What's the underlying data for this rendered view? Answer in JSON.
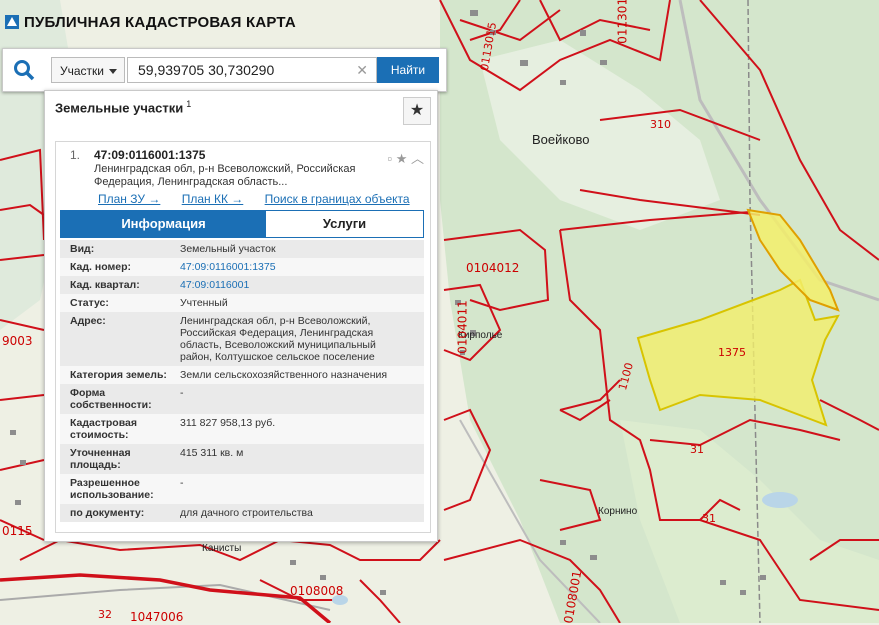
{
  "app": {
    "title": "ПУБЛИЧНАЯ КАДАСТРОВАЯ КАРТА"
  },
  "search": {
    "type_selected": "Участки",
    "query": "59,939705 30,730290",
    "button": "Найти"
  },
  "panel": {
    "title": "Земельные участки",
    "count": "1",
    "result": {
      "index": "1.",
      "cad_number": "47:09:0116001:1375",
      "address_short": "Ленинградская обл, р-н Всеволожский, Российская Федерация, Ленинградская область...",
      "links": [
        "План ЗУ →",
        "План КК →",
        "Поиск в границах объекта →"
      ],
      "tabs": [
        "Информация",
        "Услуги"
      ],
      "rows": [
        {
          "k": "Вид:",
          "v": "Земельный участок"
        },
        {
          "k": "Кад. номер:",
          "v": "47:09:0116001:1375",
          "link": true
        },
        {
          "k": "Кад. квартал:",
          "v": "47:09:0116001",
          "link": true
        },
        {
          "k": "Статус:",
          "v": "Учтенный"
        },
        {
          "k": "Адрес:",
          "v": "Ленинградская обл, р-н Всеволожский, Российская Федерация, Ленинградская область, Всеволожский муниципальный район, Колтушское сельское поселение"
        },
        {
          "k": "Категория земель:",
          "v": "Земли сельскохозяйственного назначения"
        },
        {
          "k": "Форма собственности:",
          "v": "-"
        },
        {
          "k": "Кадастровая стоимость:",
          "v": "311 827 958,13 руб."
        },
        {
          "k": "Уточненная площадь:",
          "v": "415 311 кв. м"
        },
        {
          "k": "Разрешенное использование:",
          "v": "-"
        },
        {
          "k": "по документу:",
          "v": "для дачного строительства"
        }
      ]
    }
  },
  "map": {
    "places": [
      "Воейково",
      "Кирполье",
      "Корнино",
      "Канисты"
    ],
    "parcel_numbers": [
      "310",
      "1375",
      "1100",
      "31",
      "31",
      "0104012",
      "0104011",
      "0113010",
      "0108008",
      "32",
      "1047006",
      "9003",
      "0115",
      "0108001",
      "0113015"
    ],
    "colors": {
      "boundary": "#d0101a",
      "highlight": "#f3ef6a",
      "forest": "#cfe3c6"
    }
  }
}
